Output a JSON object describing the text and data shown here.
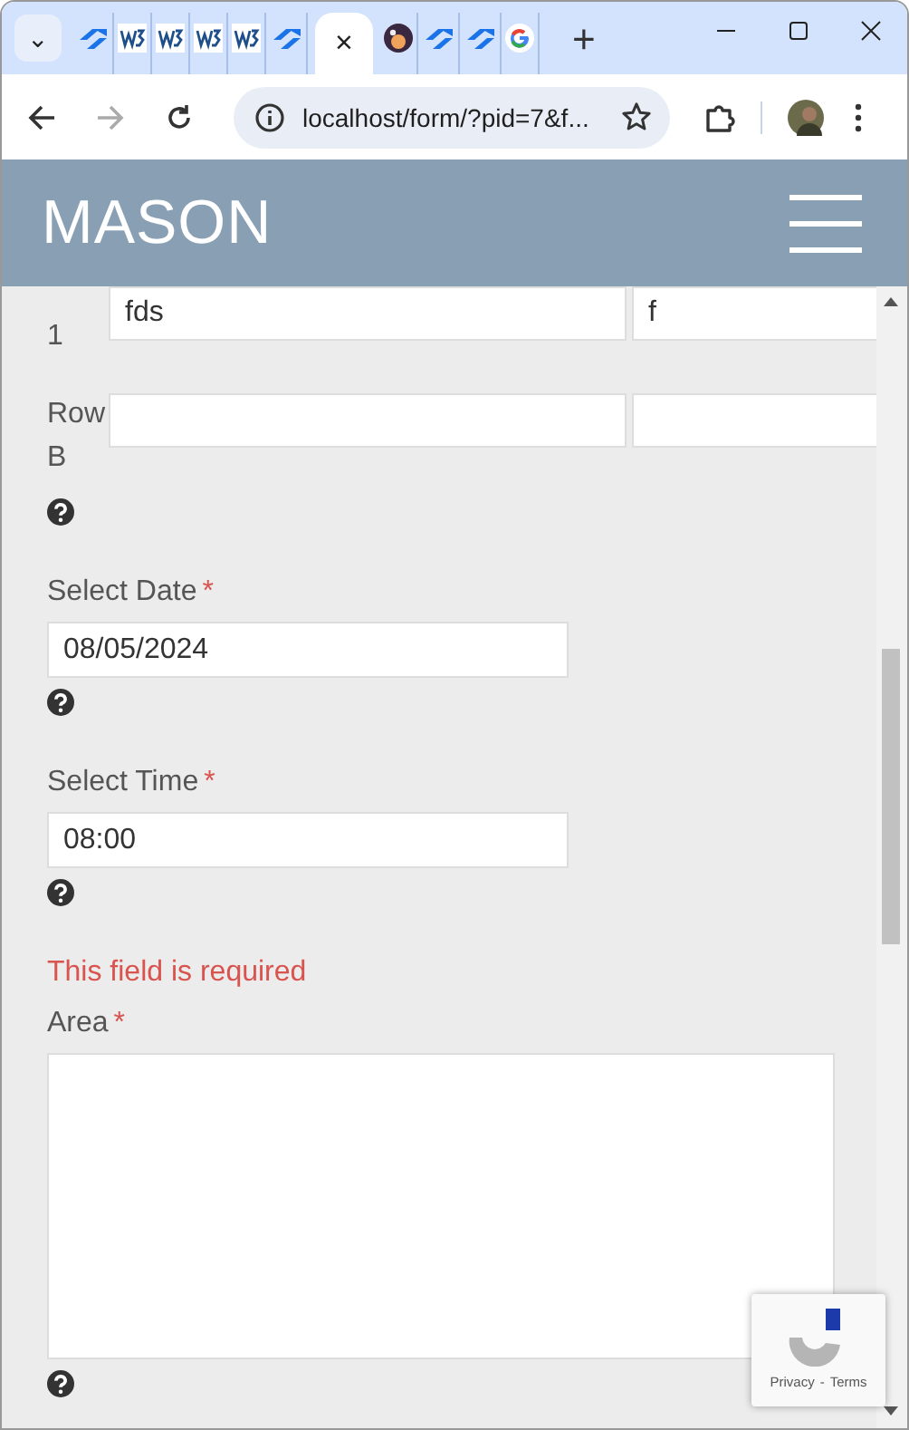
{
  "browser": {
    "tab_menu": "⌄",
    "tabs": [
      {
        "kind": "arrows",
        "selected": false
      },
      {
        "kind": "w3",
        "selected": false
      },
      {
        "kind": "w3",
        "selected": false
      },
      {
        "kind": "w3",
        "selected": false
      },
      {
        "kind": "w3",
        "selected": false
      },
      {
        "kind": "arrows",
        "selected": false
      },
      {
        "kind": "blank",
        "selected": true,
        "close": "×"
      },
      {
        "kind": "planet",
        "selected": false
      },
      {
        "kind": "arrows",
        "selected": false
      },
      {
        "kind": "arrows",
        "selected": false
      },
      {
        "kind": "google",
        "selected": false
      }
    ],
    "new_tab": "+",
    "address": "localhost/form/?pid=7&f...",
    "forward_disabled": true
  },
  "header": {
    "title": "MASON"
  },
  "grid_rows": [
    {
      "label": "1",
      "cells": [
        {
          "kind": "input",
          "value": "fds"
        },
        {
          "kind": "input",
          "value": "f"
        }
      ]
    },
    {
      "label": "Row B",
      "cells": [
        {
          "kind": "input"
        },
        {
          "kind": "input"
        }
      ]
    }
  ],
  "fields": [
    {
      "kind": "input",
      "label": "Select Date",
      "required_mark": "*",
      "value": "08/05/2024"
    },
    {
      "kind": "input",
      "label": "Select Time",
      "required_mark": "*",
      "value": "08:00"
    },
    {
      "kind": "textarea",
      "label": "Area",
      "required_mark": "*",
      "error": "This field is required"
    }
  ],
  "recaptcha": {
    "links": [
      "Privacy",
      "Terms"
    ],
    "separator": "-"
  }
}
